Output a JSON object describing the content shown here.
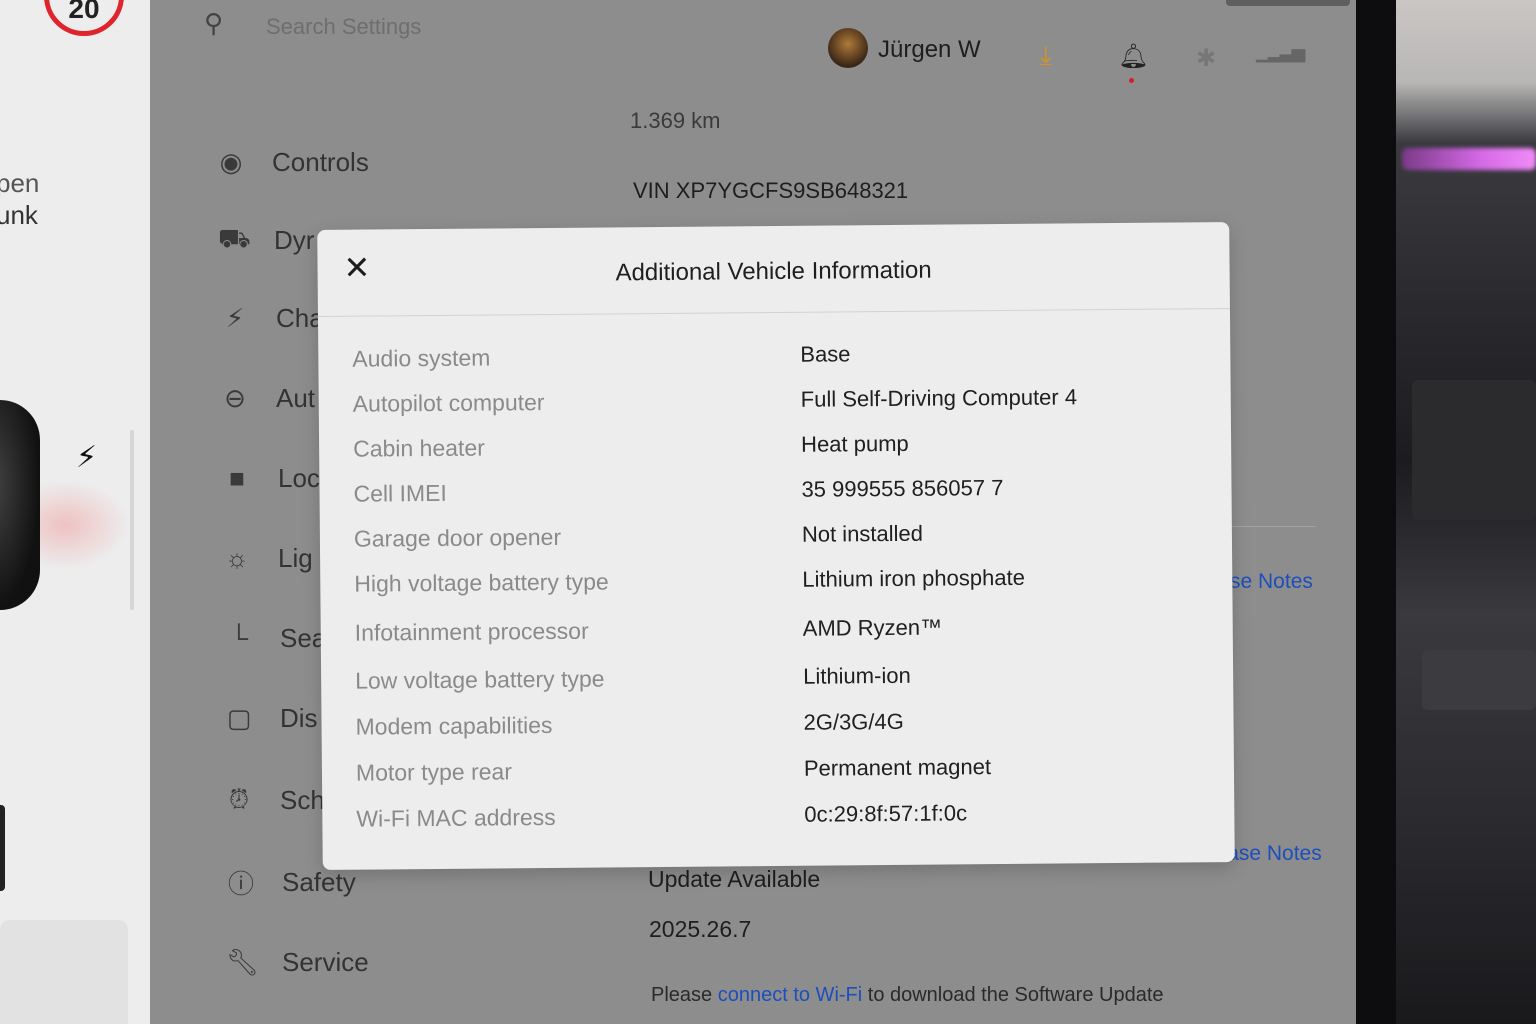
{
  "speed_limit": "20",
  "car_panel": {
    "open_label": "pen",
    "trunk_label": "unk"
  },
  "search": {
    "placeholder": "Search Settings"
  },
  "user": {
    "name": "Jürgen W"
  },
  "status_icons": [
    "download-icon",
    "bell-icon",
    "bluetooth-icon",
    "lte-signal-icon"
  ],
  "sidebar": {
    "items": [
      {
        "label": "Controls",
        "icon": "toggle-icon"
      },
      {
        "label": "Dyr",
        "icon": "car-icon"
      },
      {
        "label": "Cha",
        "icon": "bolt-icon"
      },
      {
        "label": "Aut",
        "icon": "steering-wheel-icon"
      },
      {
        "label": "Loc",
        "icon": "lock-icon"
      },
      {
        "label": "Lig",
        "icon": "sun-icon"
      },
      {
        "label": "Sea",
        "icon": "seat-icon"
      },
      {
        "label": "Dis",
        "icon": "display-icon"
      },
      {
        "label": "Sch",
        "icon": "alarm-clock-icon"
      },
      {
        "label": "Safety",
        "icon": "info-circle-icon"
      },
      {
        "label": "Service",
        "icon": "wrench-icon"
      }
    ]
  },
  "software": {
    "odometer": "1.369  km",
    "vin": "VIN XP7YGCFS9SB648321",
    "release_notes_top": "se Notes",
    "release_notes": "Release Notes",
    "update_available": "Update Available",
    "version": "2025.26.7",
    "wifi_prefix": "Please ",
    "wifi_link": "connect to Wi-Fi",
    "wifi_suffix": " to download the Software Update"
  },
  "modal": {
    "title": "Additional Vehicle Information",
    "close_icon": "close-icon",
    "rows": [
      {
        "label": "Audio system",
        "value": "Base"
      },
      {
        "label": "Autopilot computer",
        "value": "Full Self-Driving Computer 4"
      },
      {
        "label": "Cabin heater",
        "value": "Heat pump"
      },
      {
        "label": "Cell IMEI",
        "value": "35 999555 856057 7"
      },
      {
        "label": "Garage door opener",
        "value": "Not installed"
      },
      {
        "label": "High voltage battery type",
        "value": "Lithium iron phosphate"
      },
      {
        "label": "Infotainment processor",
        "value": "AMD Ryzen™"
      },
      {
        "label": "Low voltage battery type",
        "value": "Lithium-ion"
      },
      {
        "label": "Modem capabilities",
        "value": "2G/3G/4G"
      },
      {
        "label": "Motor type rear",
        "value": "Permanent magnet"
      },
      {
        "label": "Wi-Fi MAC address",
        "value": "0c:29:8f:57:1f:0c"
      }
    ]
  }
}
